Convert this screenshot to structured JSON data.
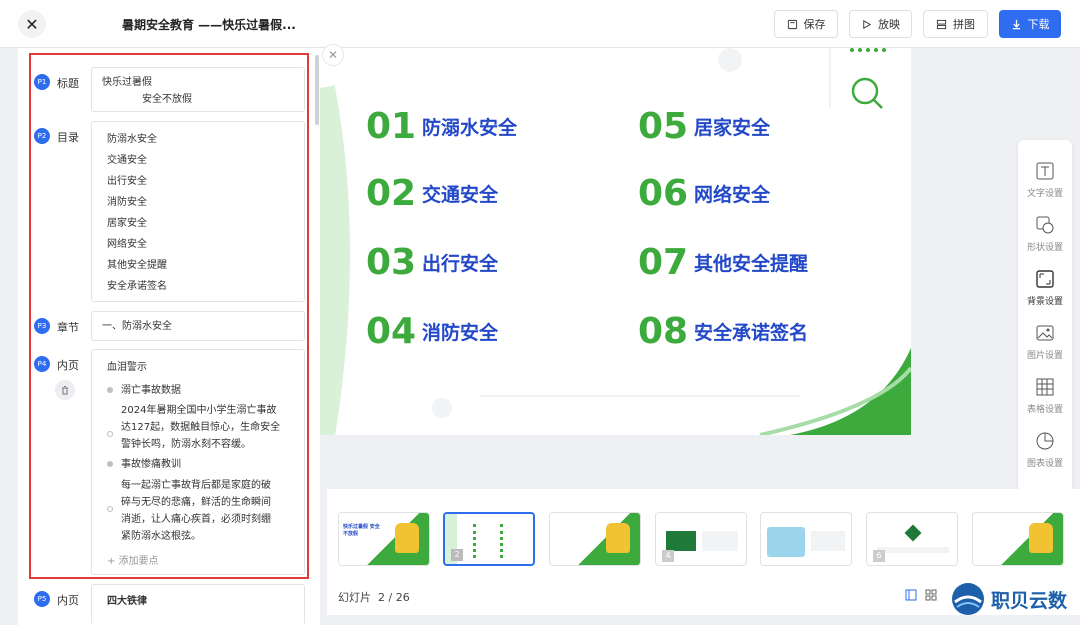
{
  "header": {
    "title": "暑期安全教育 ——快乐过暑假...",
    "buttons": {
      "save": "保存",
      "play": "放映",
      "collage": "拼图",
      "download": "下载"
    }
  },
  "outline": {
    "rows": [
      {
        "badge": "P1",
        "label": "标题",
        "lines": [
          "快乐过暑假",
          "安全不放假"
        ]
      },
      {
        "badge": "P2",
        "label": "目录",
        "lines": [
          "防溺水安全",
          "交通安全",
          "出行安全",
          "消防安全",
          "居家安全",
          "网络安全",
          "其他安全提醒",
          "安全承诺签名"
        ]
      },
      {
        "badge": "P3",
        "label": "章节",
        "lines": [
          "一、防溺水安全"
        ]
      },
      {
        "badge": "P4",
        "label": "内页",
        "heading": "血泪警示",
        "points": [
          {
            "title": "溺亡事故数据",
            "body": [
              "2024年暑期全国中小学生溺亡事故",
              "达127起，数据触目惊心，生命安全",
              "警钟长鸣，防溺水刻不容缓。"
            ]
          },
          {
            "title": "事故惨痛教训",
            "body": [
              "每一起溺亡事故背后都是家庭的破",
              "碎与无尽的悲痛，鲜活的生命瞬间",
              "消逝，让人痛心疾首，必须时刻绷",
              "紧防溺水这根弦。"
            ]
          }
        ],
        "add_point": "+ 添加要点"
      },
      {
        "badge": "P5",
        "label": "内页",
        "heading": "四大铁律"
      }
    ]
  },
  "slide": {
    "items": [
      {
        "num": "01",
        "text": "防溺水安全"
      },
      {
        "num": "02",
        "text": "交通安全"
      },
      {
        "num": "03",
        "text": "出行安全"
      },
      {
        "num": "04",
        "text": "消防安全"
      },
      {
        "num": "05",
        "text": "居家安全"
      },
      {
        "num": "06",
        "text": "网络安全"
      },
      {
        "num": "07",
        "text": "其他安全提醒"
      },
      {
        "num": "08",
        "text": "安全承诺签名"
      }
    ]
  },
  "tools": [
    "文字设置",
    "形状设置",
    "背景设置",
    "图片设置",
    "表格设置",
    "图表设置"
  ],
  "thumbs": {
    "slide1_title": "快乐过暑假 安全不放假",
    "count_label": "幻灯片",
    "current": "2 / 26"
  },
  "watermark": "职贝云数",
  "colors": {
    "accent": "#2f6df0",
    "green": "#3caa3c",
    "slide_text": "#2349c8",
    "frame": "#e53935"
  }
}
